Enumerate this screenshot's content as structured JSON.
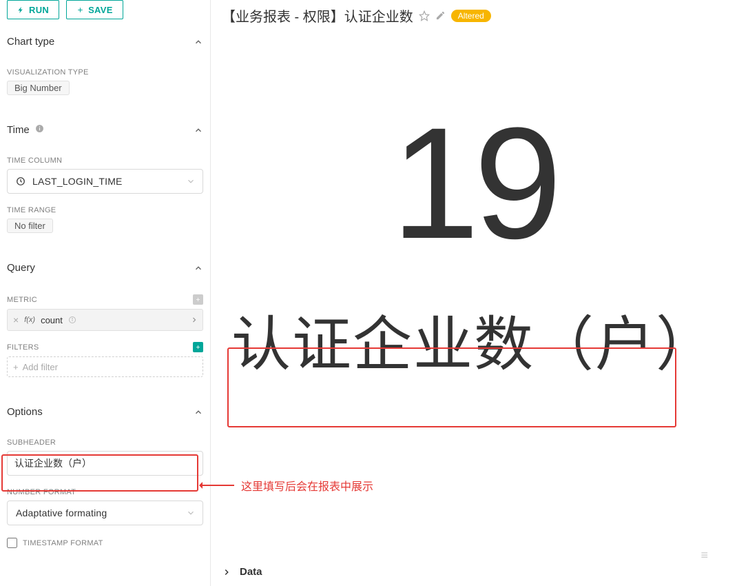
{
  "toolbar": {
    "run_label": "RUN",
    "save_label": "SAVE"
  },
  "sections": {
    "chart_type": {
      "title": "Chart type",
      "viz_type_label": "VISUALIZATION TYPE",
      "viz_type_value": "Big Number"
    },
    "time": {
      "title": "Time",
      "time_column_label": "TIME COLUMN",
      "time_column_value": "LAST_LOGIN_TIME",
      "time_range_label": "TIME RANGE",
      "time_range_value": "No filter"
    },
    "query": {
      "title": "Query",
      "metric_label": "METRIC",
      "metric_fx": "f(x)",
      "metric_value": "count",
      "filters_label": "FILTERS",
      "filters_placeholder": "Add filter"
    },
    "options": {
      "title": "Options",
      "subheader_label": "SUBHEADER",
      "subheader_value": "认证企业数（户）",
      "number_format_label": "NUMBER FORMAT",
      "number_format_value": "Adaptative formating",
      "timestamp_format_label": "TIMESTAMP FORMAT"
    }
  },
  "chart": {
    "title": "【业务报表 - 权限】认证企业数",
    "altered_badge": "Altered",
    "big_number": "19",
    "subheader": "认证企业数（户）"
  },
  "annotation": "这里填写后会在报表中展示",
  "bottom": {
    "data_label": "Data"
  }
}
